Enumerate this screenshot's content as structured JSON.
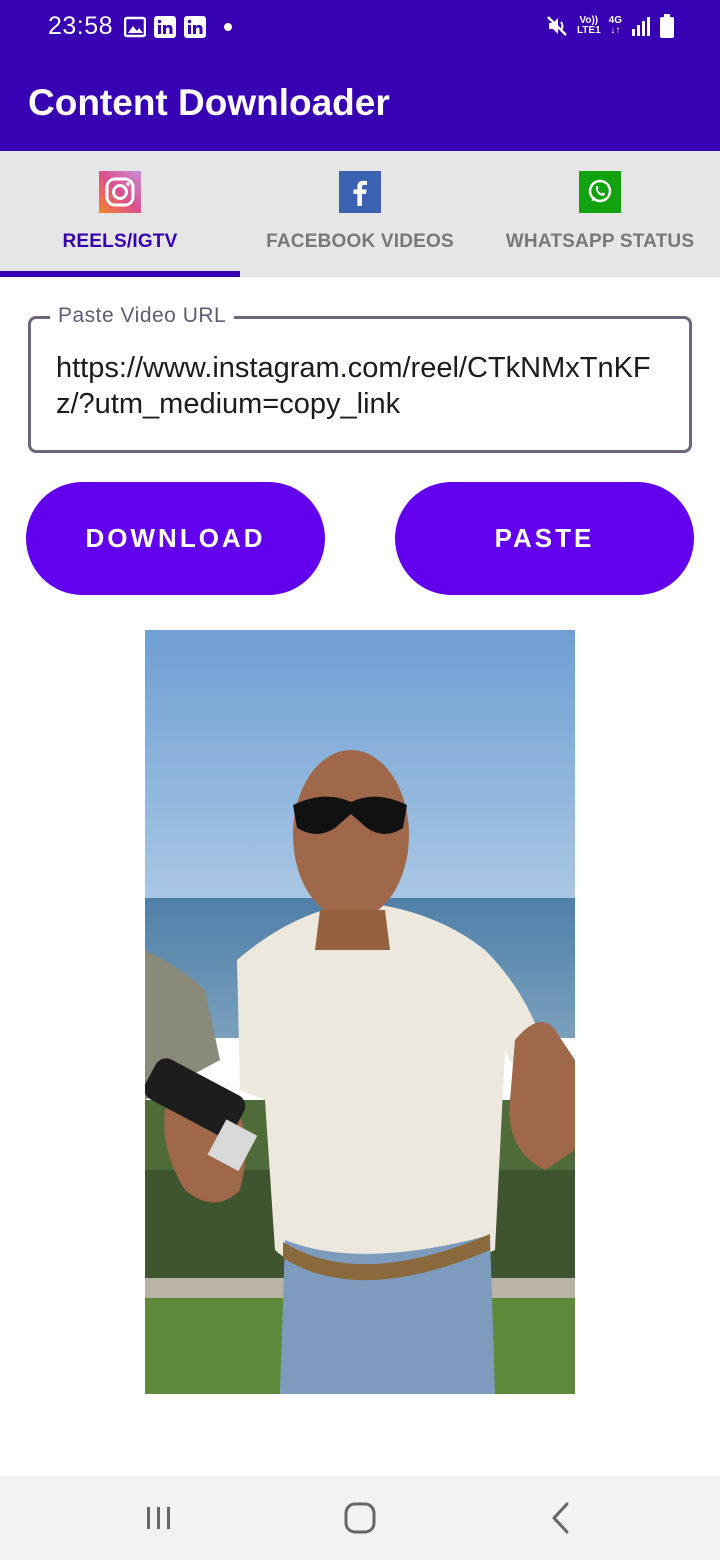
{
  "status_bar": {
    "time": "23:58",
    "left_icons": [
      "image-icon",
      "linkedin-icon",
      "linkedin-icon",
      "notification-dot"
    ],
    "net_top": "Vo))",
    "net_bottom": "LTE1",
    "net_type": "4G",
    "right_icons": [
      "mute-icon",
      "signal-icon",
      "battery-icon"
    ]
  },
  "app_bar": {
    "title": "Content Downloader",
    "color": "#3700b3"
  },
  "tabs": [
    {
      "label": "REELS/IGTV",
      "icon": "instagram-icon",
      "active": true
    },
    {
      "label": "FACEBOOK VIDEOS",
      "icon": "facebook-icon",
      "active": false
    },
    {
      "label": "WHATSAPP STATUS",
      "icon": "whatsapp-icon",
      "active": false
    }
  ],
  "url_field": {
    "label": "Paste Video URL",
    "value": "https://www.instagram.com/reel/CTkNMxTnKFz/?utm_medium=copy_link"
  },
  "buttons": {
    "download": "DOWNLOAD",
    "paste": "PASTE",
    "color": "#6200ee"
  },
  "preview": {
    "image": "video-thumbnail"
  },
  "nav_bar": {
    "icons": [
      "recent-apps-icon",
      "home-icon",
      "back-icon"
    ]
  }
}
